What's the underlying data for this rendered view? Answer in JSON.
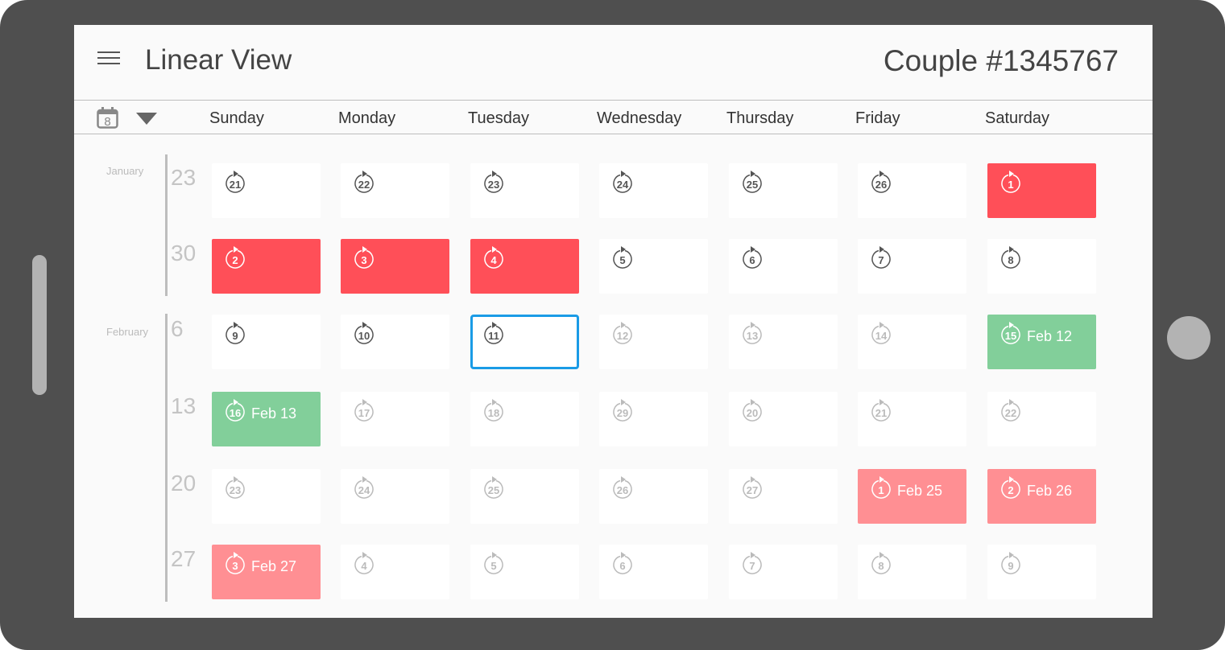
{
  "header": {
    "title": "Linear View",
    "couple": "Couple #1345767"
  },
  "toolbar": {
    "calendar_day": "8"
  },
  "days": [
    "Sunday",
    "Monday",
    "Tuesday",
    "Wednesday",
    "Thursday",
    "Friday",
    "Saturday"
  ],
  "months": [
    {
      "label": "January"
    },
    {
      "label": "February"
    }
  ],
  "weeks": [
    {
      "label": "23",
      "cells": [
        {
          "n": "21",
          "s": "normal"
        },
        {
          "n": "22",
          "s": "normal"
        },
        {
          "n": "23",
          "s": "normal"
        },
        {
          "n": "24",
          "s": "normal"
        },
        {
          "n": "25",
          "s": "normal"
        },
        {
          "n": "26",
          "s": "normal"
        },
        {
          "n": "1",
          "s": "red"
        }
      ]
    },
    {
      "label": "30",
      "cells": [
        {
          "n": "2",
          "s": "red"
        },
        {
          "n": "3",
          "s": "red"
        },
        {
          "n": "4",
          "s": "red"
        },
        {
          "n": "5",
          "s": "normal"
        },
        {
          "n": "6",
          "s": "normal"
        },
        {
          "n": "7",
          "s": "normal"
        },
        {
          "n": "8",
          "s": "normal"
        }
      ]
    },
    {
      "label": "6",
      "cells": [
        {
          "n": "9",
          "s": "normal"
        },
        {
          "n": "10",
          "s": "normal"
        },
        {
          "n": "11",
          "s": "sel"
        },
        {
          "n": "12",
          "s": "faded"
        },
        {
          "n": "13",
          "s": "faded"
        },
        {
          "n": "14",
          "s": "faded"
        },
        {
          "n": "15",
          "s": "green",
          "label": "Feb 12"
        }
      ]
    },
    {
      "label": "13",
      "cells": [
        {
          "n": "16",
          "s": "green",
          "label": "Feb 13"
        },
        {
          "n": "17",
          "s": "faded"
        },
        {
          "n": "18",
          "s": "faded"
        },
        {
          "n": "29",
          "s": "faded"
        },
        {
          "n": "20",
          "s": "faded"
        },
        {
          "n": "21",
          "s": "faded"
        },
        {
          "n": "22",
          "s": "faded"
        }
      ]
    },
    {
      "label": "20",
      "cells": [
        {
          "n": "23",
          "s": "faded"
        },
        {
          "n": "24",
          "s": "faded"
        },
        {
          "n": "25",
          "s": "faded"
        },
        {
          "n": "26",
          "s": "faded"
        },
        {
          "n": "27",
          "s": "faded"
        },
        {
          "n": "1",
          "s": "pink",
          "label": "Feb 25"
        },
        {
          "n": "2",
          "s": "pink",
          "label": "Feb 26"
        }
      ]
    },
    {
      "label": "27",
      "cells": [
        {
          "n": "3",
          "s": "pink",
          "label": "Feb 27"
        },
        {
          "n": "4",
          "s": "faded"
        },
        {
          "n": "5",
          "s": "faded"
        },
        {
          "n": "6",
          "s": "faded"
        },
        {
          "n": "7",
          "s": "faded"
        },
        {
          "n": "8",
          "s": "faded"
        },
        {
          "n": "9",
          "s": "faded"
        }
      ]
    }
  ],
  "colors": {
    "red": "#ff4f58",
    "green": "#82cf9a",
    "pink": "#ff8f93",
    "selected": "#1a9be6"
  }
}
